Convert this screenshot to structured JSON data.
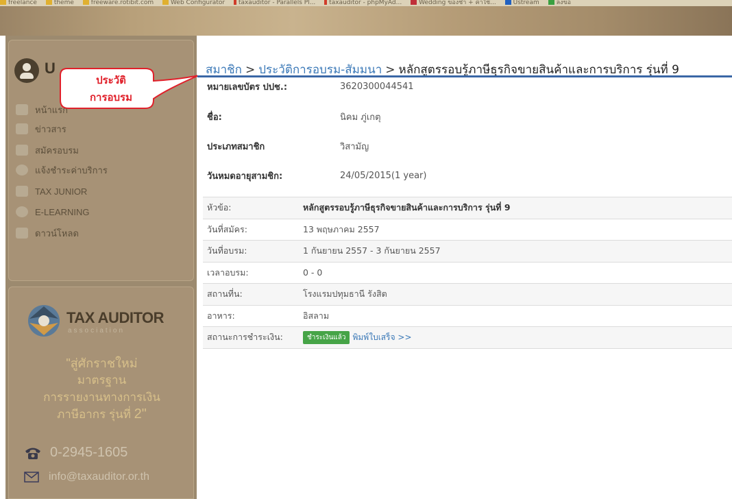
{
  "bookmarks": [
    {
      "label": "freelance",
      "color": "#e0b030"
    },
    {
      "label": "theme",
      "color": "#e0b030"
    },
    {
      "label": "freeware.rotibit.com",
      "color": "#e0b030"
    },
    {
      "label": "Web Configurator",
      "color": "#e0b030"
    },
    {
      "label": "taxauditor - Parallels Pl...",
      "color": "#d03c2a"
    },
    {
      "label": "taxauditor - phpMyAd...",
      "color": "#d03c2a"
    },
    {
      "label": "Wedding ของชำ + ค่าใช้...",
      "color": "#c0303a"
    },
    {
      "label": "Ustream",
      "color": "#2060c0"
    },
    {
      "label": "ลงขอ",
      "color": "#3aa040"
    }
  ],
  "sidebar": {
    "user_initial": "U",
    "nav_items": [
      {
        "label": "หน้าแรก",
        "icon": "home-icon"
      },
      {
        "label": "ข่าวสาร",
        "icon": "news-icon"
      },
      {
        "label": "สมัครอบรม",
        "icon": "register-icon"
      },
      {
        "label": "แจ้งชำระค่าบริการ",
        "icon": "payment-icon"
      },
      {
        "label": "TAX JUNIOR",
        "icon": "junior-icon"
      },
      {
        "label": "E-LEARNING",
        "icon": "elearning-icon"
      },
      {
        "label": "ดาวน์โหลด",
        "icon": "download-icon"
      }
    ],
    "logo": {
      "name": "TAX AUDITOR",
      "subtitle": "association"
    },
    "promo": {
      "line1": "\"สู่ศักราชใหม่",
      "line2": "มาตรฐาน",
      "line3": "การรายงานทางการเงิน",
      "line4_prefix": "ภาษีอากร รุ่นที่",
      "line4_number": "2\""
    },
    "phone": "0-2945-1605",
    "email": "info@taxauditor.or.th"
  },
  "callout": {
    "line1": "ประวัติ",
    "line2": "การอบรม",
    "color": "#e0202a"
  },
  "breadcrumb": {
    "item1": "สมาชิก",
    "item2": "ประวัติการอบรม-สัมมนา",
    "current": "หลักสูตรรอบรู้ภาษีธุรกิจขายสินค้าและการบริการ รุ่นที่ 9",
    "separator": ">"
  },
  "member_info": [
    {
      "label": "หมายเลขบัตร ปปช.:",
      "value": "3620300044541"
    },
    {
      "label": "ชื่อ:",
      "value": "นิคม ภู่เกตุ"
    },
    {
      "label": "ประเภทสมาชิก",
      "value": "วิสามัญ"
    },
    {
      "label": "วันหมดอายุสามชิก:",
      "value": "24/05/2015(1 year)"
    }
  ],
  "course_details": [
    {
      "label": "หัวข้อ:",
      "value": "หลักสูตรรอบรู้ภาษีธุรกิจขายสินค้าและการบริการ รุ่นที่ 9"
    },
    {
      "label": "วันที่สมัคร:",
      "value": "13 พฤษภาคม 2557"
    },
    {
      "label": "วันที่อบรม:",
      "value": "1 กันยายน 2557 - 3 กันยายน 2557"
    },
    {
      "label": "เวลาอบรม:",
      "value": "0 - 0"
    },
    {
      "label": "สถานที่น:",
      "value": "โรงแรมปทุมธานี รังสิต"
    },
    {
      "label": "อาหาร:",
      "value": "อิสลาม"
    },
    {
      "label": "สถานะการชำระเงิน:",
      "status": "ชำระเงินแล้ว",
      "link": "พิมพ์ใบเสร็จ >>"
    }
  ],
  "colors": {
    "link": "#3a78b7",
    "accent_rule": "#3a67a6",
    "paid_badge": "#46a447"
  }
}
